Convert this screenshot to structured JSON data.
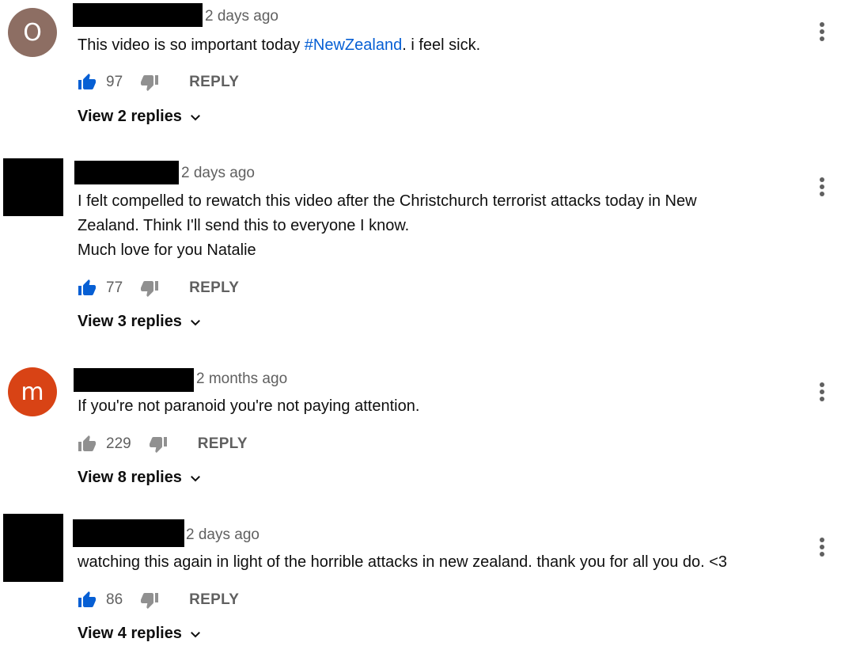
{
  "comments": [
    {
      "avatar_letter": "O",
      "avatar_color": "#8d6e63",
      "time": "2 days ago",
      "text_before": "This video is so important today ",
      "hashtag": "#NewZealand",
      "text_after": ". i feel sick.",
      "likes": "97",
      "liked": true,
      "reply_label": "REPLY",
      "view_replies": "View 2 replies"
    },
    {
      "time": "2 days ago",
      "lines": [
        "I felt compelled to rewatch this video after the Christchurch terrorist attacks today in New",
        "Zealand. Think I'll send this to everyone I know.",
        "Much love for you Natalie"
      ],
      "likes": "77",
      "liked": true,
      "reply_label": "REPLY",
      "view_replies": "View 3 replies"
    },
    {
      "avatar_letter": "m",
      "avatar_color": "#d84315",
      "time": "2 months ago",
      "text": "If you're not paranoid you're not paying attention.",
      "likes": "229",
      "liked": false,
      "reply_label": "REPLY",
      "view_replies": "View 8 replies"
    },
    {
      "time": "2 days ago",
      "text": "watching this again in light of the horrible attacks in new zealand. thank you for all you do. <3",
      "likes": "86",
      "liked": true,
      "reply_label": "REPLY",
      "view_replies": "View 4 replies"
    }
  ],
  "colors": {
    "like_active": "#065fd4",
    "like_inactive": "#909090",
    "dislike": "#909090",
    "hashtag": "#065fd4"
  },
  "icons": [
    "thumb-up-icon",
    "thumb-down-icon",
    "chevron-down-icon",
    "more-vert-icon"
  ]
}
